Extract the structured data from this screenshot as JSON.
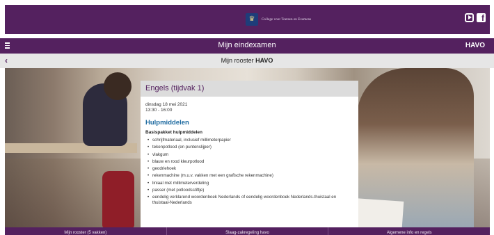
{
  "header": {
    "logo_text": "College voor Toetsen en Examens",
    "logo_icon": "crest-icon",
    "social": [
      "youtube-icon",
      "facebook-icon"
    ]
  },
  "nav": {
    "title": "Mijn eindexamen",
    "badge": "HAVO"
  },
  "subnav": {
    "back_icon": "chevron-left-icon",
    "title_prefix": "Mijn rooster",
    "title_bold": "HAVO"
  },
  "card": {
    "title": "Engels (tijdvak 1)",
    "date": "dinsdag 18 mei 2021",
    "time": "13:30 - 16:00",
    "section_title": "Hulpmiddelen",
    "sub_heading": "Basispakket hulpmiddelen",
    "items": [
      "schrijfmateriaal, inclusief millimeterpapier",
      "tekenpotlood (en puntenslijper)",
      "vlakgum",
      "blauw en rood kleurpotlood",
      "geodriehoek",
      "rekenmachine (m.u.v. vakken met een grafische rekenmachine)",
      "liniaal met millimeterverdeling",
      "passer (met potloodsstiftje)",
      "eendelig verklarend woordenboek Nederlands of eendelig woordenboek Nederlands-thuistaal en thuistaal-Nederlands"
    ]
  },
  "footer": {
    "items": [
      "Mijn rooster (5 vakken)",
      "Slaag-zakregeling havo",
      "Algemene info en regels"
    ]
  },
  "colors": {
    "brand": "#54215f",
    "link": "#1d6aa0",
    "subbar": "#e6e6e6"
  }
}
